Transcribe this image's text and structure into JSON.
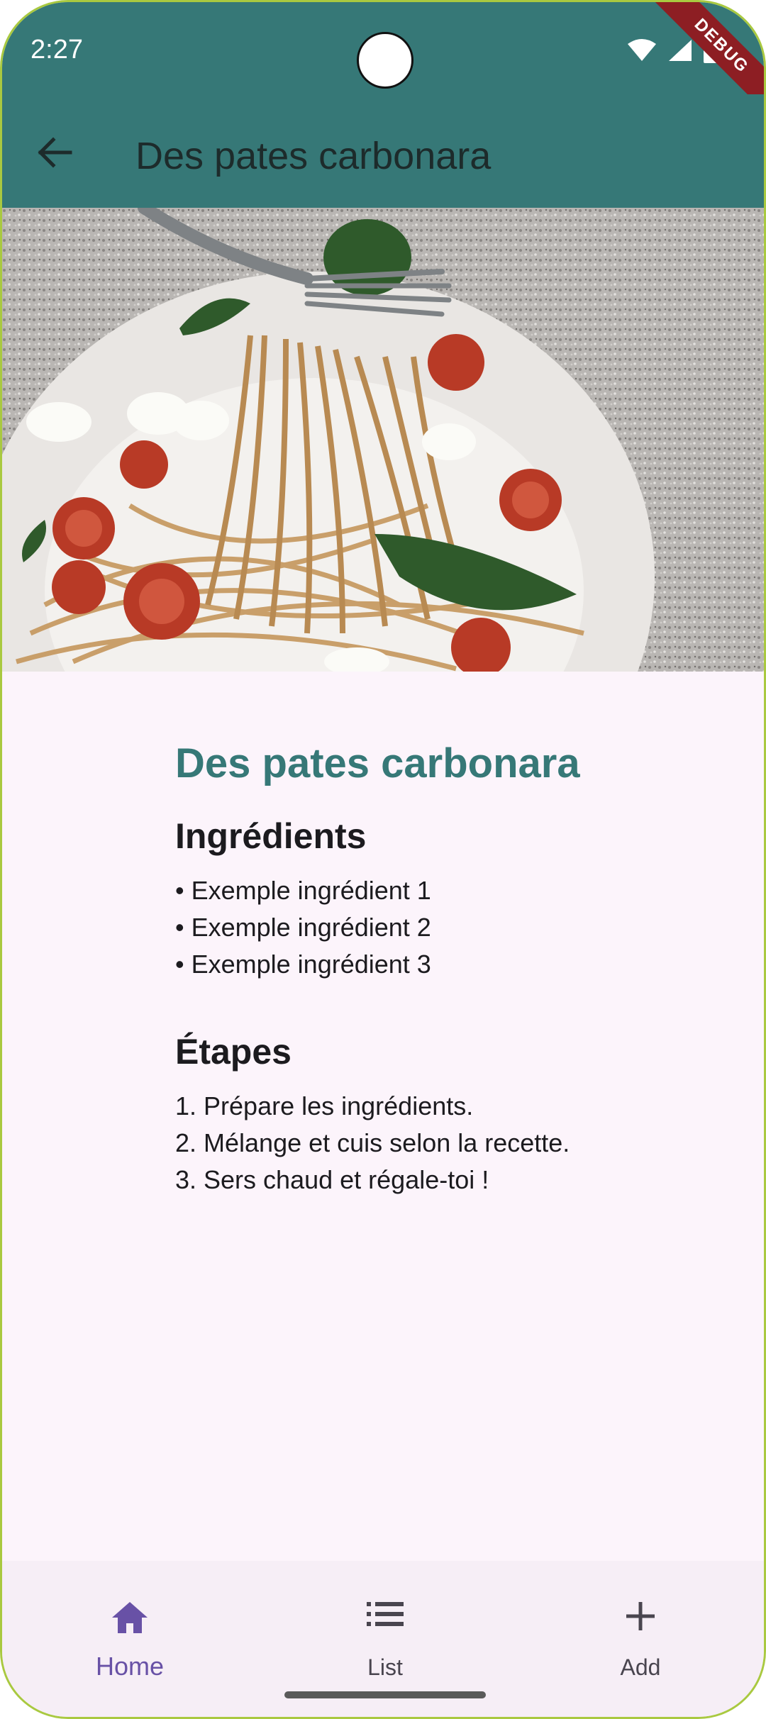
{
  "status_bar": {
    "time": "2:27",
    "debug_label": "DEBUG"
  },
  "app_bar": {
    "title": "Des pates carbonara"
  },
  "recipe": {
    "title": "Des pates carbonara",
    "ingredients_heading": "Ingrédients",
    "ingredients": [
      "• Exemple ingrédient 1",
      "• Exemple ingrédient 2",
      "• Exemple ingrédient 3"
    ],
    "steps_heading": "Étapes",
    "steps": [
      "1. Prépare les ingrédients.",
      "2. Mélange et cuis selon la recette.",
      "3. Sers chaud et régale-toi !"
    ]
  },
  "bottom_nav": {
    "items": [
      {
        "label": "Home",
        "icon": "home-icon",
        "active": true
      },
      {
        "label": "List",
        "icon": "list-icon",
        "active": false
      },
      {
        "label": "Add",
        "icon": "add-icon",
        "active": false
      }
    ]
  },
  "colors": {
    "primary": "#367877",
    "nav_active": "#6851a6",
    "background": "#fcf4fb"
  }
}
